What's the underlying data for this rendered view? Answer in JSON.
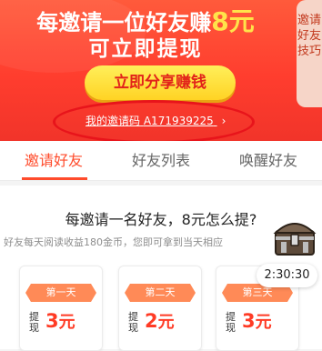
{
  "hero": {
    "headline_prefix": "每邀请一位好友赚",
    "headline_amount": "8元",
    "subheadline": "可立即提现",
    "share_button_label": "立即分享赚钱",
    "invite_code_label": "我的邀请码",
    "invite_code_value": "A171939225",
    "chevron_glyph": "›"
  },
  "side_tab": {
    "label": "邀请好友技巧"
  },
  "tabs": [
    {
      "label": "邀请好友",
      "active": true
    },
    {
      "label": "好友列表",
      "active": false
    },
    {
      "label": "唤醒好友",
      "active": false
    }
  ],
  "card": {
    "title": "每邀请一名好友，8元怎么提?",
    "subtitle": "好友每天阅读收益180金币，您即可拿到当天相应"
  },
  "days": [
    {
      "label": "第一天",
      "withdraw_label": "提现",
      "amount": "3",
      "unit": "元"
    },
    {
      "label": "第二天",
      "withdraw_label": "提现",
      "amount": "2",
      "unit": "元"
    },
    {
      "label": "第三天",
      "withdraw_label": "提现",
      "amount": "3",
      "unit": "元"
    }
  ],
  "timer": {
    "value": "2:30:30"
  },
  "colors": {
    "accent": "#ff4b2b",
    "hero": "#ff3d2e",
    "highlight": "#ffe34a",
    "annotation": "#e8141b"
  }
}
